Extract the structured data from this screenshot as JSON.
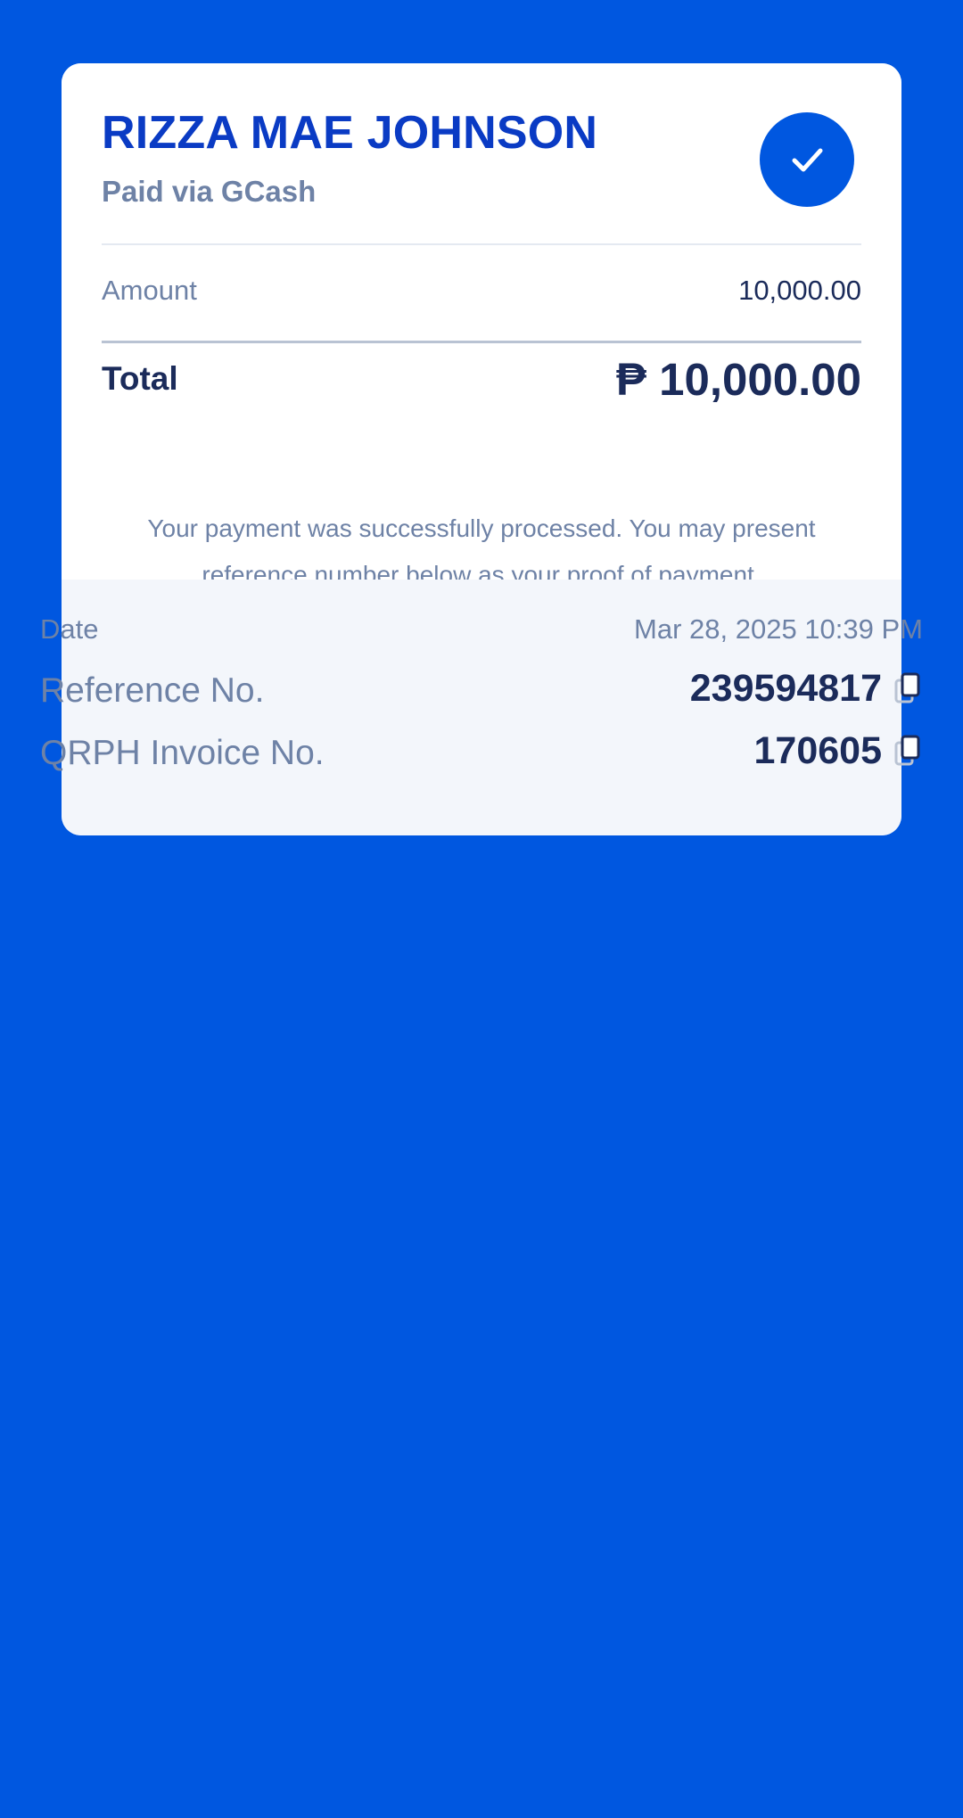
{
  "receipt": {
    "recipient_name": "RIZZA MAE JOHNSON",
    "paid_via": "Paid via GCash",
    "status_icon": "check-icon",
    "amount_label": "Amount",
    "amount_value": "10,000.00",
    "total_label": "Total",
    "total_value": "₱ 10,000.00",
    "message": "Your payment was successfully processed. You may present reference number below as your proof of payment."
  },
  "details": {
    "date_label": "Date",
    "date_value": "Mar 28, 2025 10:39 PM",
    "reference_label": "Reference No.",
    "reference_value": "239594817",
    "invoice_label": "QRPH Invoice No.",
    "invoice_value": "170605",
    "copy_icon": "copy-icon"
  },
  "colors": {
    "background": "#0057e0",
    "card": "#ffffff",
    "details_panel": "#f3f6fb",
    "title": "#0a3bc4",
    "primary_text": "#1b2b5a",
    "secondary_text": "#6e82a6"
  }
}
